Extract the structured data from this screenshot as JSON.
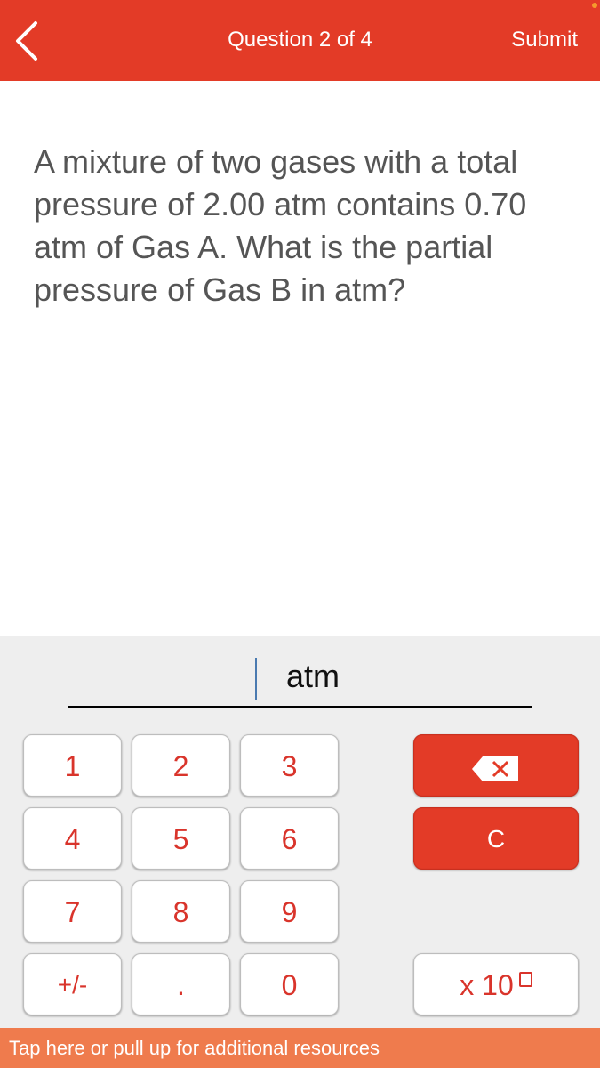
{
  "header": {
    "title": "Question 2 of 4",
    "submit_label": "Submit",
    "back_icon": "chevron-left-icon",
    "bg_color": "#e33b27"
  },
  "question": {
    "text": "A mixture of two gases with a total pressure of 2.00 atm contains 0.70 atm of Gas A. What is the partial pressure of Gas B in atm?"
  },
  "answer": {
    "value": "",
    "unit": "atm"
  },
  "keypad": {
    "digits": [
      "1",
      "2",
      "3",
      "4",
      "5",
      "6",
      "7",
      "8",
      "9"
    ],
    "sign_label": "+/-",
    "decimal_label": ".",
    "zero_label": "0",
    "backspace_icon": "backspace-icon",
    "clear_label": "C",
    "exponent_label": "x 10",
    "accent_color": "#d9342b"
  },
  "footer": {
    "text": "Tap here or pull up for additional resources",
    "bg_color": "#ef7b4d"
  }
}
